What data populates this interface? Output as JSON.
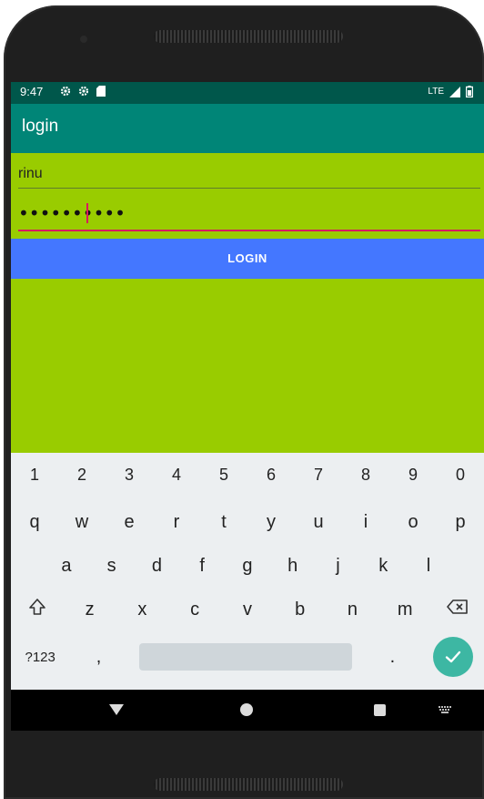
{
  "status_bar": {
    "time": "9:47",
    "network": "LTE",
    "left_icons": [
      "gear-icon",
      "gear-icon",
      "sd-card-icon"
    ],
    "right_icons": [
      "signal-icon",
      "battery-icon"
    ]
  },
  "app_bar": {
    "title": "login"
  },
  "form": {
    "username_value": "rinu",
    "password_dots": "••••••••••",
    "login_label": "LOGIN"
  },
  "keyboard": {
    "numbers": [
      "1",
      "2",
      "3",
      "4",
      "5",
      "6",
      "7",
      "8",
      "9",
      "0"
    ],
    "row1": [
      "q",
      "w",
      "e",
      "r",
      "t",
      "y",
      "u",
      "i",
      "o",
      "p"
    ],
    "row2": [
      "a",
      "s",
      "d",
      "f",
      "g",
      "h",
      "j",
      "k",
      "l"
    ],
    "row3": [
      "z",
      "x",
      "c",
      "v",
      "b",
      "n",
      "m"
    ],
    "symbols_label": "?123",
    "comma": ",",
    "period": "."
  },
  "colors": {
    "status_bar": "#00574b",
    "app_bar": "#008577",
    "screen_background": "#99cc00",
    "login_button": "#4477ff",
    "accent": "#d81b60",
    "keyboard_background": "#eceff1",
    "enter_key": "#3db7a3"
  }
}
